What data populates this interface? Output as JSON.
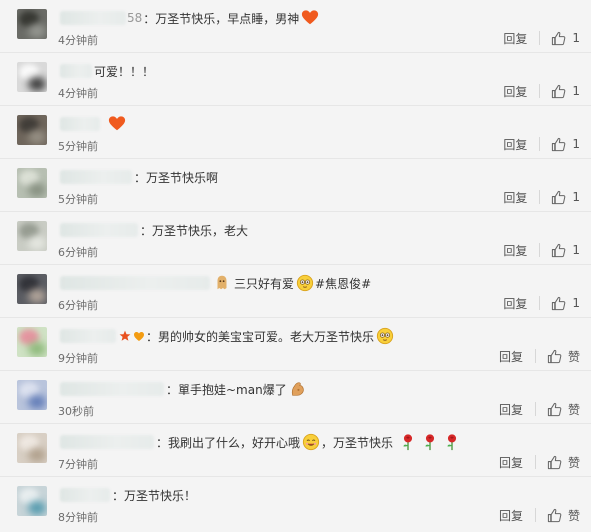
{
  "comments": [
    {
      "username_tail": "58",
      "content": "：万圣节快乐，早点睡，男神",
      "time": "4分钟前",
      "reply_label": "回复",
      "like_label": "1"
    },
    {
      "username_tail": "",
      "content": "可爱！！！",
      "time": "4分钟前",
      "reply_label": "回复",
      "like_label": "1"
    },
    {
      "username_tail": "",
      "content": "",
      "time": "5分钟前",
      "reply_label": "回复",
      "like_label": "1"
    },
    {
      "username_tail": "",
      "content": "：万圣节快乐啊",
      "time": "5分钟前",
      "reply_label": "回复",
      "like_label": "1"
    },
    {
      "username_tail": "",
      "content": "：万圣节快乐，老大",
      "time": "6分钟前",
      "reply_label": "回复",
      "like_label": "1"
    },
    {
      "username_tail": "",
      "content": "三只好有爱",
      "topic": "#焦恩俊#",
      "time": "6分钟前",
      "reply_label": "回复",
      "like_label": "1"
    },
    {
      "username_tail": "",
      "content": "：男的帅女的美宝宝可爱。老大万圣节快乐",
      "time": "9分钟前",
      "reply_label": "回复",
      "like_label": "赞"
    },
    {
      "username_tail": "",
      "content": "：單手抱娃~man爆了",
      "time": "30秒前",
      "reply_label": "回复",
      "like_label": "赞"
    },
    {
      "username_tail": "",
      "content": "：我刷出了什么，好开心哦",
      "content_after": "，万圣节快乐",
      "time": "7分钟前",
      "reply_label": "回复",
      "like_label": "赞"
    },
    {
      "username_tail": "",
      "content": "：万圣节快乐！",
      "time": "8分钟前",
      "reply_label": "回复",
      "like_label": "赞"
    }
  ],
  "colors": {
    "username": "#eb7350",
    "background": "#f4f4f4",
    "divider": "#e6e6e6"
  }
}
